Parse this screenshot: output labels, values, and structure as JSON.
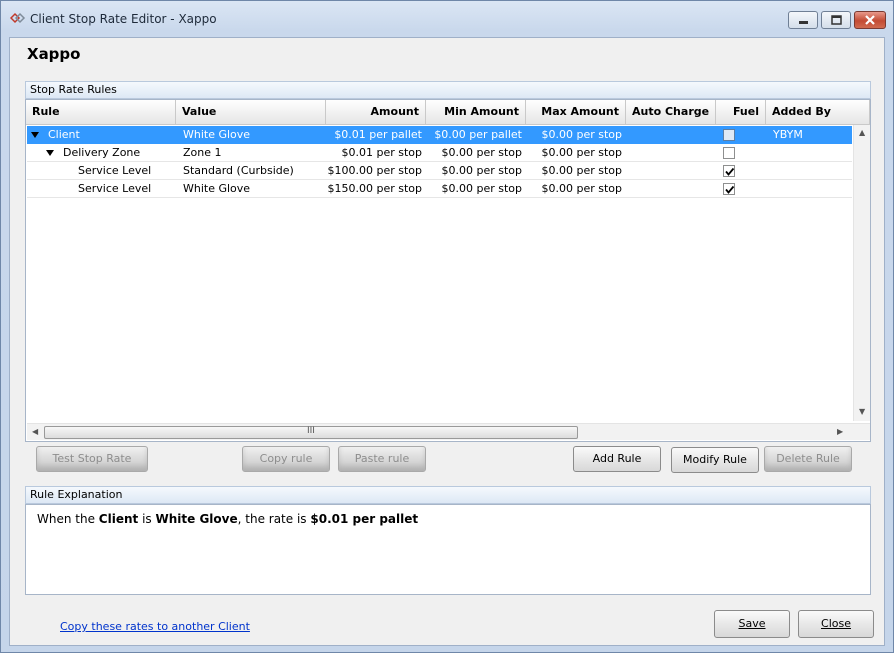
{
  "window": {
    "title": "Client Stop Rate Editor - Xappo",
    "app_title": "Xappo"
  },
  "rules_group": {
    "label": "Stop Rate Rules"
  },
  "columns": {
    "rule": "Rule",
    "value": "Value",
    "amount": "Amount",
    "min_amount": "Min Amount",
    "max_amount": "Max Amount",
    "auto_charge": "Auto Charge",
    "fuel": "Fuel",
    "added_by": "Added By"
  },
  "rows": [
    {
      "rule": "Client",
      "value": "White Glove",
      "amount": "$0.01 per pallet",
      "min_amount": "$0.00 per pallet",
      "max_amount": "$0.00 per stop",
      "auto_charge": "",
      "fuel": false,
      "added_by": "YBYM",
      "expanded": true,
      "selected": true
    },
    {
      "rule": "Delivery Zone",
      "value": "Zone 1",
      "amount": "$0.01 per stop",
      "min_amount": "$0.00 per stop",
      "max_amount": "$0.00 per stop",
      "auto_charge": "",
      "fuel": false,
      "added_by": "",
      "expanded": true,
      "selected": false
    },
    {
      "rule": "Service Level",
      "value": "Standard (Curbside)",
      "amount": "$100.00 per stop",
      "min_amount": "$0.00 per stop",
      "max_amount": "$0.00 per stop",
      "auto_charge": "",
      "fuel": true,
      "added_by": "",
      "selected": false
    },
    {
      "rule": "Service Level",
      "value": "White Glove",
      "amount": "$150.00 per stop",
      "min_amount": "$0.00 per stop",
      "max_amount": "$0.00 per stop",
      "auto_charge": "",
      "fuel": true,
      "added_by": "",
      "selected": false
    }
  ],
  "scrollbar": {
    "grip": "III"
  },
  "buttons": {
    "test_stop_rate": "Test Stop Rate",
    "copy_rule": "Copy rule",
    "paste_rule": "Paste rule",
    "add_rule": "Add Rule",
    "modify_rule": "Modify Rule",
    "delete_rule": "Delete Rule",
    "save": "Save",
    "close": "Close"
  },
  "explanation": {
    "label": "Rule Explanation",
    "prefix": "When the",
    "subject": "Client",
    "mid": "is",
    "object": "White Glove",
    "mid2": ", the rate is",
    "rate": "$0.01 per pallet"
  },
  "footer": {
    "copy_link": "Copy these rates to another Client"
  },
  "colors": {
    "selection": "#3399ff",
    "link": "#0033cc"
  }
}
